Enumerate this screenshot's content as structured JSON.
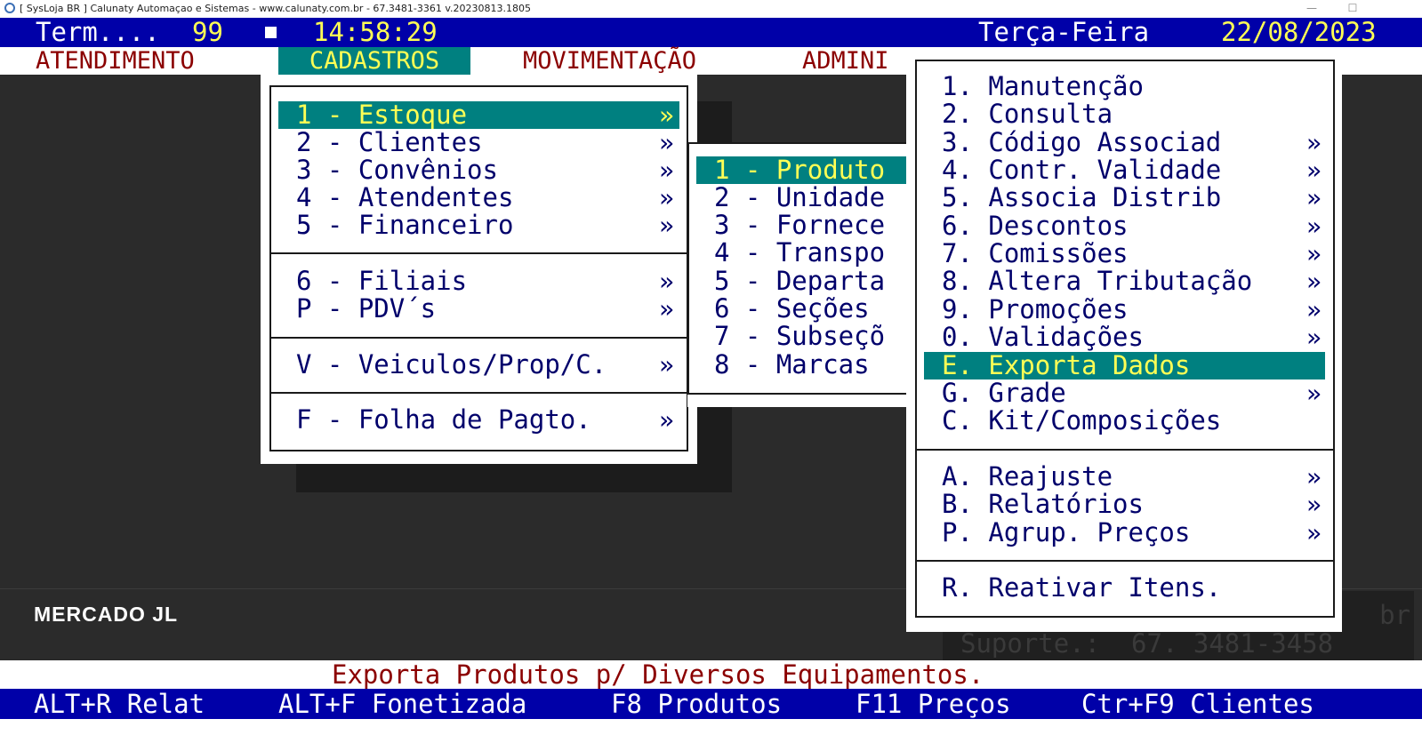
{
  "window": {
    "title": "[ SysLoja BR ]   Calunaty Automaçao e Sistemas  -  www.calunaty.com.br  -  67.3481-3361   v.20230813.1805",
    "minimize": "—",
    "maximize": "☐"
  },
  "topbar": {
    "term_label": "Term....",
    "term_value": "99",
    "time": "14:58:29",
    "day": "Terça-Feira",
    "date": "22/08/2023"
  },
  "menubar": [
    "ATENDIMENTO",
    "CADASTROS",
    "MOVIMENTAÇÃO",
    "ADMINI"
  ],
  "cadastros_menu": {
    "items": [
      {
        "label": "1 - Estoque",
        "arrow": "»",
        "selected": true
      },
      {
        "label": "2 - Clientes",
        "arrow": "»"
      },
      {
        "label": "3 - Convênios",
        "arrow": "»"
      },
      {
        "label": "4 - Atendentes",
        "arrow": "»"
      },
      {
        "label": "5 - Financeiro",
        "arrow": "»"
      },
      {
        "label": "6 - Filiais",
        "arrow": "»"
      },
      {
        "label": "P - PDV´s",
        "arrow": "»"
      },
      {
        "label": "V - Veiculos/Prop/C.",
        "arrow": "»"
      },
      {
        "label": "F - Folha de Pagto.",
        "arrow": "»"
      }
    ]
  },
  "estoque_menu": {
    "items": [
      {
        "label": "1 - Produto",
        "selected": true
      },
      {
        "label": "2 - Unidade"
      },
      {
        "label": "3 - Fornece"
      },
      {
        "label": "4 - Transpo"
      },
      {
        "label": "5 - Departa"
      },
      {
        "label": "6 - Seções"
      },
      {
        "label": "7 - Subseçõ"
      },
      {
        "label": "8 - Marcas"
      }
    ]
  },
  "produto_menu": {
    "items": [
      {
        "label": "1. Manutenção",
        "arrow": ""
      },
      {
        "label": "2. Consulta",
        "arrow": ""
      },
      {
        "label": "3. Código Associad",
        "arrow": "»"
      },
      {
        "label": "4. Contr. Validade",
        "arrow": "»"
      },
      {
        "label": "5. Associa Distrib",
        "arrow": "»"
      },
      {
        "label": "6. Descontos",
        "arrow": "»"
      },
      {
        "label": "7. Comissões",
        "arrow": "»"
      },
      {
        "label": "8. Altera Tributação",
        "arrow": "»"
      },
      {
        "label": "9. Promoções",
        "arrow": "»"
      },
      {
        "label": "0. Validações",
        "arrow": "»"
      },
      {
        "label": "E. Exporta Dados",
        "arrow": "",
        "selected": true
      },
      {
        "label": "G. Grade",
        "arrow": "»"
      },
      {
        "label": "C. Kit/Composições",
        "arrow": ""
      },
      {
        "label": "A. Reajuste",
        "arrow": "»"
      },
      {
        "label": "B. Relatórios",
        "arrow": "»"
      },
      {
        "label": "P. Agrup. Preços",
        "arrow": "»"
      },
      {
        "label": "R. Reativar Itens.",
        "arrow": ""
      }
    ]
  },
  "company": "MERCADO JL",
  "suporte": {
    "line1": "br",
    "line2": "Suporte.:  67. 3481-3458"
  },
  "status_message": "Exporta Produtos p/ Diversos Equipamentos.",
  "function_keys": [
    "ALT+R Relat",
    "ALT+F Fonetizada",
    "F8 Produtos",
    "F11 Preços",
    "Ctr+F9 Clientes"
  ],
  "colors": {
    "blue_bar": "#0000a8",
    "highlight": "#008080",
    "highlight_text": "#ffff55",
    "menu_text": "#00006b",
    "menubar_text": "#8b0000"
  }
}
